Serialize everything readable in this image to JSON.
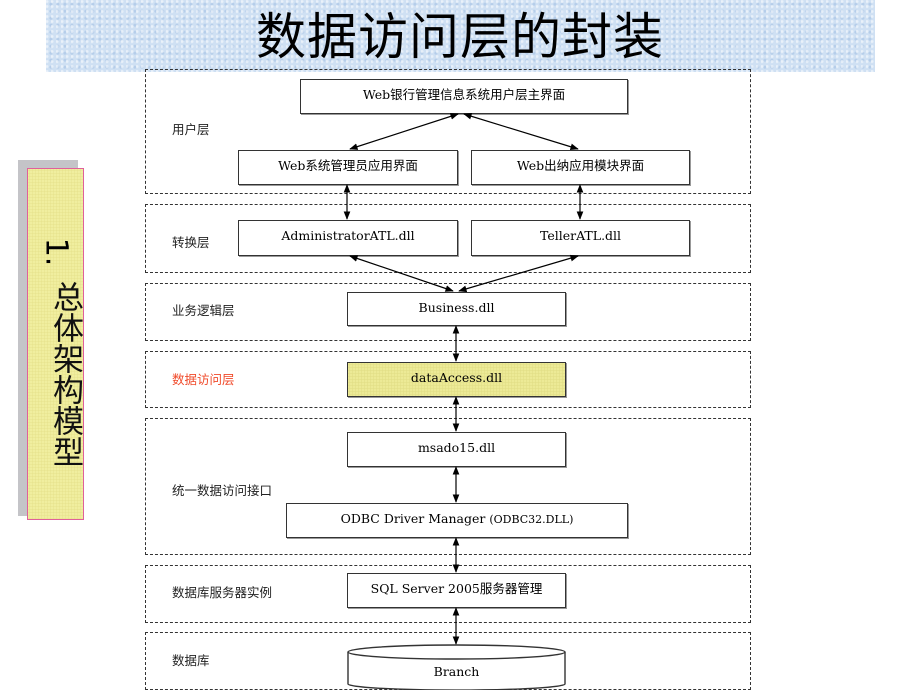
{
  "page": {
    "title": "数据访问层的封装",
    "side_label": {
      "number": "1.",
      "text": "总体架构模型"
    }
  },
  "colors": {
    "banner": "#cfe0f3",
    "highlight_fill": "#f0ee9c",
    "side_box_fill": "#f3f1a4",
    "side_box_border": "#e0609a",
    "highlight_label": "#f04a2a"
  },
  "layers": [
    {
      "label": "用户层",
      "highlighted": false
    },
    {
      "label": "转换层",
      "highlighted": false
    },
    {
      "label": "业务逻辑层",
      "highlighted": false
    },
    {
      "label": "数据访问层",
      "highlighted": true
    },
    {
      "label": "统一数据访问接口",
      "highlighted": false
    },
    {
      "label": "数据库服务器实例",
      "highlighted": false
    },
    {
      "label": "数据库",
      "highlighted": false
    }
  ],
  "nodes": {
    "main_ui": "Web银行管理信息系统用户层主界面",
    "admin_ui": "Web系统管理员应用界面",
    "teller_ui": "Web出纳应用模块界面",
    "admin_atl": "AdministratorATL.dll",
    "teller_atl": "TellerATL.dll",
    "business": "Business.dll",
    "data_access": "dataAccess.dll",
    "msado": "msado15.dll",
    "odbc_main": "ODBC Driver Manager",
    "odbc_sub": "(ODBC32.DLL)",
    "sql_server": "SQL Server 2005服务器管理",
    "database": "Branch"
  },
  "edges": [
    {
      "from": "main_ui",
      "to": "admin_ui",
      "type": "bidirectional"
    },
    {
      "from": "main_ui",
      "to": "teller_ui",
      "type": "bidirectional"
    },
    {
      "from": "admin_ui",
      "to": "admin_atl",
      "type": "bidirectional"
    },
    {
      "from": "teller_ui",
      "to": "teller_atl",
      "type": "bidirectional"
    },
    {
      "from": "admin_atl",
      "to": "business",
      "type": "bidirectional"
    },
    {
      "from": "teller_atl",
      "to": "business",
      "type": "bidirectional"
    },
    {
      "from": "business",
      "to": "data_access",
      "type": "bidirectional"
    },
    {
      "from": "data_access",
      "to": "msado",
      "type": "bidirectional"
    },
    {
      "from": "msado",
      "to": "odbc_main",
      "type": "bidirectional"
    },
    {
      "from": "odbc_main",
      "to": "sql_server",
      "type": "bidirectional"
    },
    {
      "from": "sql_server",
      "to": "database",
      "type": "bidirectional"
    }
  ]
}
